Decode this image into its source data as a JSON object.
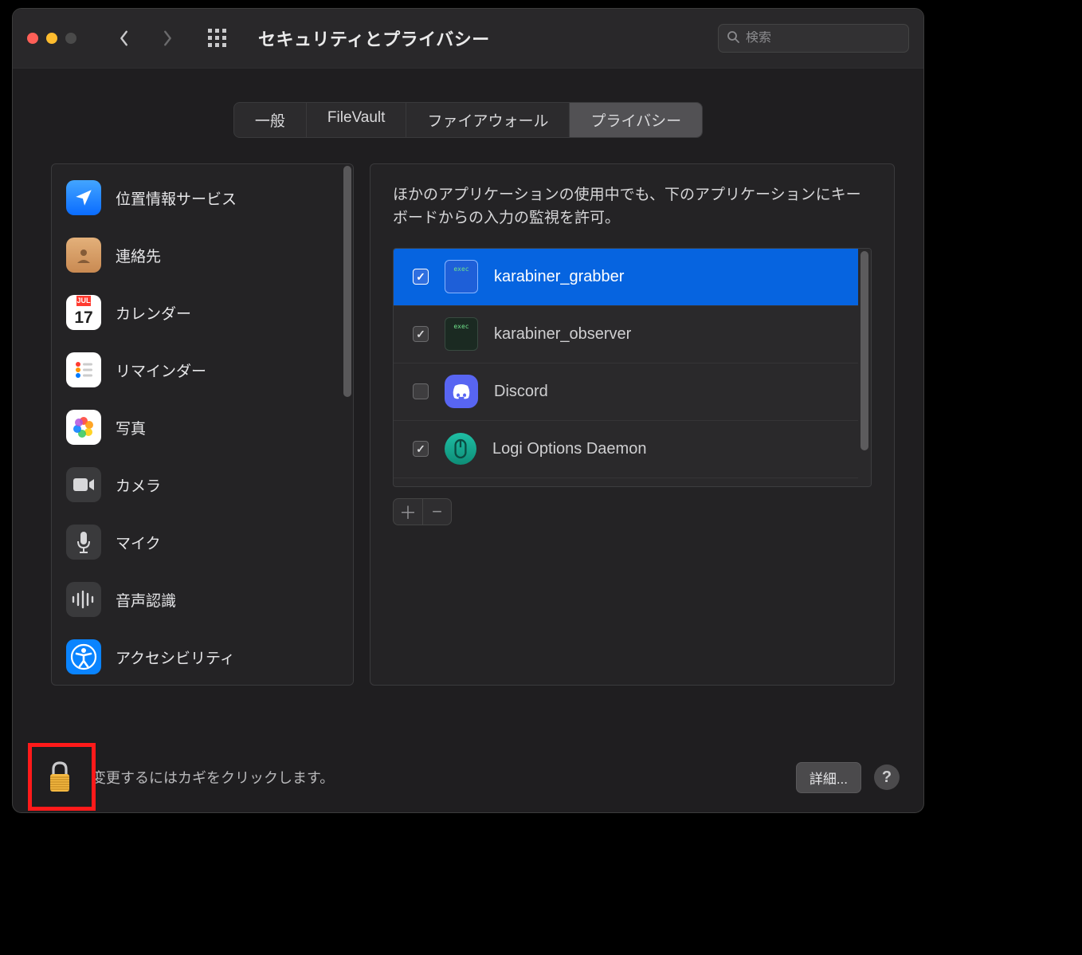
{
  "window": {
    "title": "セキュリティとプライバシー",
    "search_placeholder": "検索"
  },
  "tabs": [
    {
      "label": "一般",
      "active": false
    },
    {
      "label": "FileVault",
      "active": false
    },
    {
      "label": "ファイアウォール",
      "active": false
    },
    {
      "label": "プライバシー",
      "active": true
    }
  ],
  "sidebar": {
    "items": [
      {
        "label": "位置情報サービス",
        "icon": "location"
      },
      {
        "label": "連絡先",
        "icon": "contacts"
      },
      {
        "label": "カレンダー",
        "icon": "calendar",
        "cal_top": "JUL",
        "cal_num": "17"
      },
      {
        "label": "リマインダー",
        "icon": "reminders"
      },
      {
        "label": "写真",
        "icon": "photos"
      },
      {
        "label": "カメラ",
        "icon": "camera"
      },
      {
        "label": "マイク",
        "icon": "mic"
      },
      {
        "label": "音声認識",
        "icon": "speech"
      },
      {
        "label": "アクセシビリティ",
        "icon": "accessibility"
      }
    ]
  },
  "panel": {
    "description": "ほかのアプリケーションの使用中でも、下のアプリケーションにキーボードからの入力の監視を許可。",
    "apps": [
      {
        "name": "karabiner_grabber",
        "checked": true,
        "selected": true,
        "icon": "term-blue",
        "exec_label": "exec"
      },
      {
        "name": "karabiner_observer",
        "checked": true,
        "selected": false,
        "icon": "term-dark",
        "exec_label": "exec"
      },
      {
        "name": "Discord",
        "checked": false,
        "selected": false,
        "icon": "discord"
      },
      {
        "name": "Logi Options Daemon",
        "checked": true,
        "selected": false,
        "icon": "logi"
      }
    ]
  },
  "footer": {
    "lock_text": "変更するにはカギをクリックします。",
    "details_label": "詳細...",
    "help_label": "?"
  }
}
